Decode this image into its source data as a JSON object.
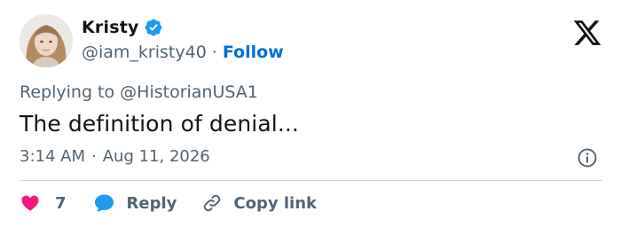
{
  "author": {
    "display_name": "Kristy",
    "handle": "@iam_kristy40",
    "separator": "·",
    "follow_label": "Follow",
    "verified_color": "#1d9bf0"
  },
  "reply_context": {
    "prefix": "Replying to ",
    "mention": "@HistorianUSA1"
  },
  "tweet": {
    "text": "The definition of denial...",
    "time": "3:14 AM",
    "separator": "·",
    "date": "Aug 11, 2026"
  },
  "actions": {
    "like_count": "7",
    "reply_label": "Reply",
    "copy_link_label": "Copy link"
  },
  "colors": {
    "text": "#0f1419",
    "secondary": "#536471",
    "link": "#006fd6",
    "like": "#f91880",
    "reply_icon": "#1d9bf0",
    "divider": "#cfd9de"
  },
  "icons": {
    "brand": "x-logo-icon",
    "verified": "verified-badge-icon",
    "info": "info-icon",
    "like": "heart-icon",
    "reply": "speech-bubble-icon",
    "copy": "link-icon"
  }
}
